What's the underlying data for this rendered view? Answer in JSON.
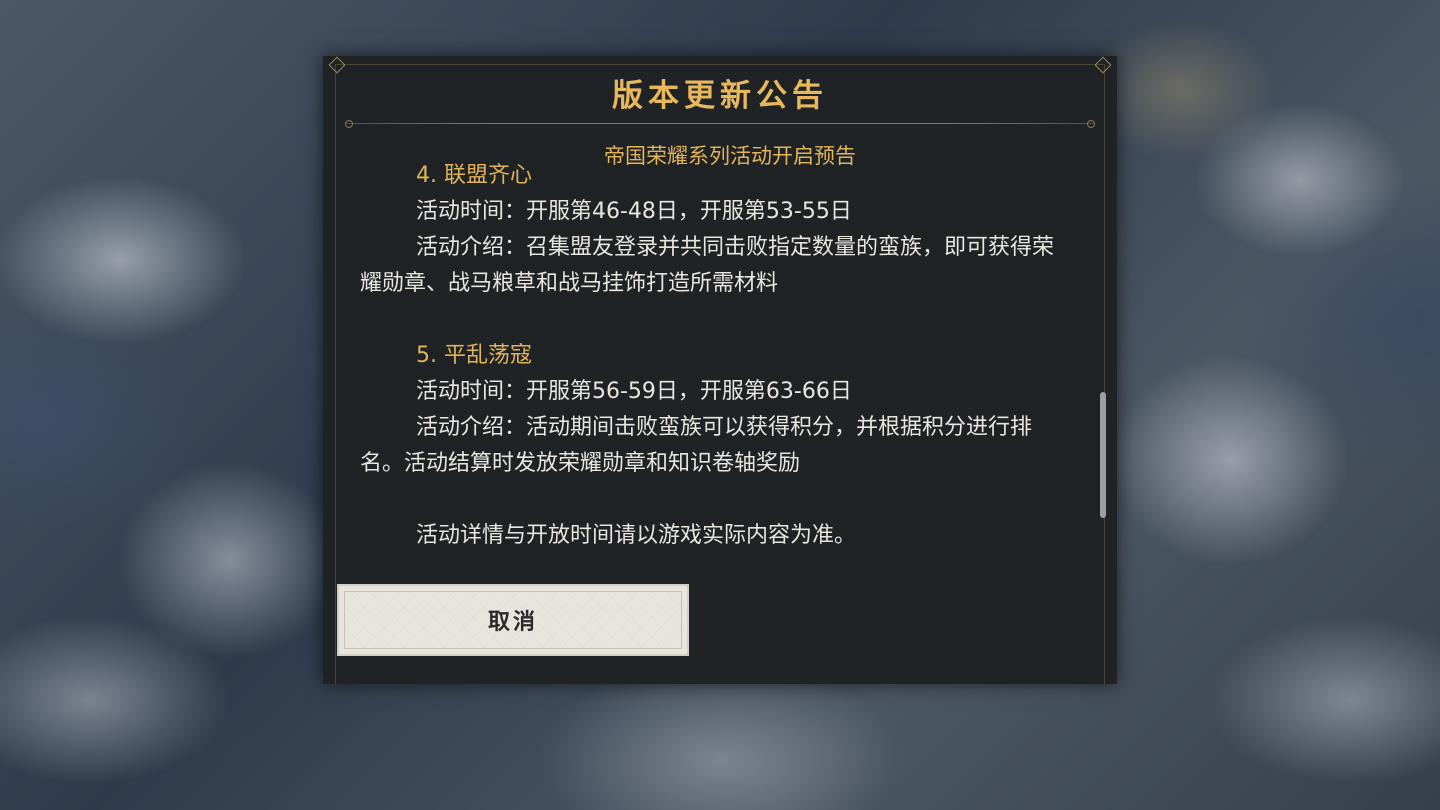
{
  "dialog": {
    "title": "版本更新公告",
    "subtitle": "帝国荣耀系列活动开启预告",
    "sections": [
      {
        "heading": "4. 联盟齐心",
        "time": "活动时间：开服第46-48日，开服第53-55日",
        "intro": "活动介绍：召集盟友登录并共同击败指定数量的蛮族，即可获得荣耀勋章、战马粮草和战马挂饰打造所需材料"
      },
      {
        "heading": "5. 平乱荡寇",
        "time": "活动时间：开服第56-59日，开服第63-66日",
        "intro": "活动介绍：活动期间击败蛮族可以获得积分，并根据积分进行排名。活动结算时发放荣耀勋章和知识卷轴奖励"
      }
    ],
    "note": "活动详情与开放时间请以游戏实际内容为准。",
    "cancel_label": "取消"
  },
  "colors": {
    "accent_gold": "#e2b45a",
    "dialog_bg": "#1f2326",
    "body_text": "#e8e6df"
  }
}
